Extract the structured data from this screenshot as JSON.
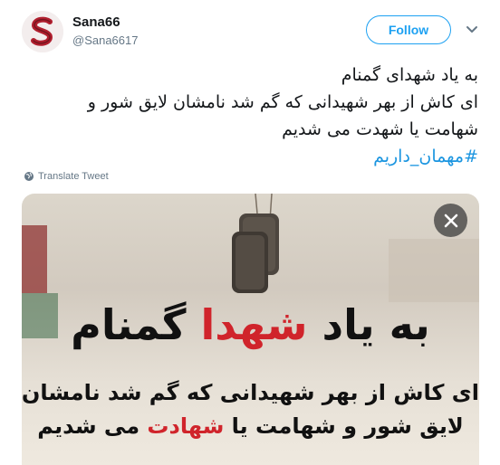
{
  "user": {
    "display_name": "Sana66",
    "handle": "@Sana6617",
    "avatar_letter": "S"
  },
  "actions": {
    "follow_label": "Follow",
    "translate_label": "Translate Tweet"
  },
  "tweet": {
    "line1": "به یاد شهدای گمنام",
    "line2": "ای کاش از بهر شهیدانی که گم شد نامشان لایق شور و",
    "line3": "شهامت یا شهدت می شدیم",
    "hashtag": "#مهمان_داریم"
  },
  "image_text": {
    "title_part1": "به یاد ",
    "title_highlight": "شهدا",
    "title_part2": " گمنام",
    "line1": "ای کاش از بهر شهیدانی که گم شد نامشان",
    "line2_part1": "لایق شور و شهامت یا ",
    "line2_highlight": "شهادت",
    "line2_part2": " می شدیم"
  },
  "colors": {
    "accent": "#1da1f2",
    "hashtag": "#1b95e0",
    "highlight_red": "#d0242b",
    "avatar_red": "#b01e2e"
  },
  "icons": {
    "globe": "globe-icon",
    "close": "close-icon",
    "caret": "chevron-down-icon"
  }
}
